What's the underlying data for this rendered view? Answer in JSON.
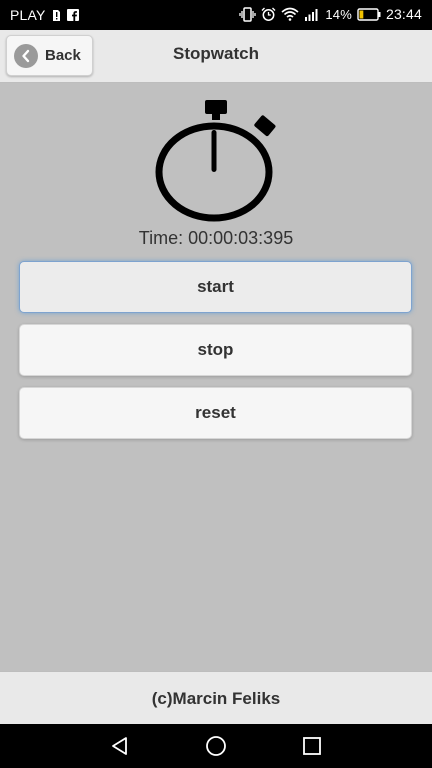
{
  "status_bar": {
    "carrier": "PLAY",
    "battery_percent": "14%",
    "time": "23:44",
    "icons": [
      "sim-alert-icon",
      "facebook-icon",
      "vibrate-icon",
      "alarm-icon",
      "wifi-icon",
      "signal-icon",
      "battery-icon"
    ],
    "battery_color": "#f2c200"
  },
  "header": {
    "back_label": "Back",
    "title": "Stopwatch"
  },
  "main": {
    "icon": "stopwatch-icon",
    "time_text": "Time: 00:00:03:395",
    "buttons": {
      "start": "start",
      "stop": "stop",
      "reset": "reset"
    },
    "focused_button": "start",
    "focus_color": "#7ea3cf"
  },
  "footer": {
    "text": "(c)Marcin Feliks"
  },
  "nav_bar": {
    "icons": [
      "nav-back-icon",
      "nav-home-icon",
      "nav-recents-icon"
    ]
  }
}
